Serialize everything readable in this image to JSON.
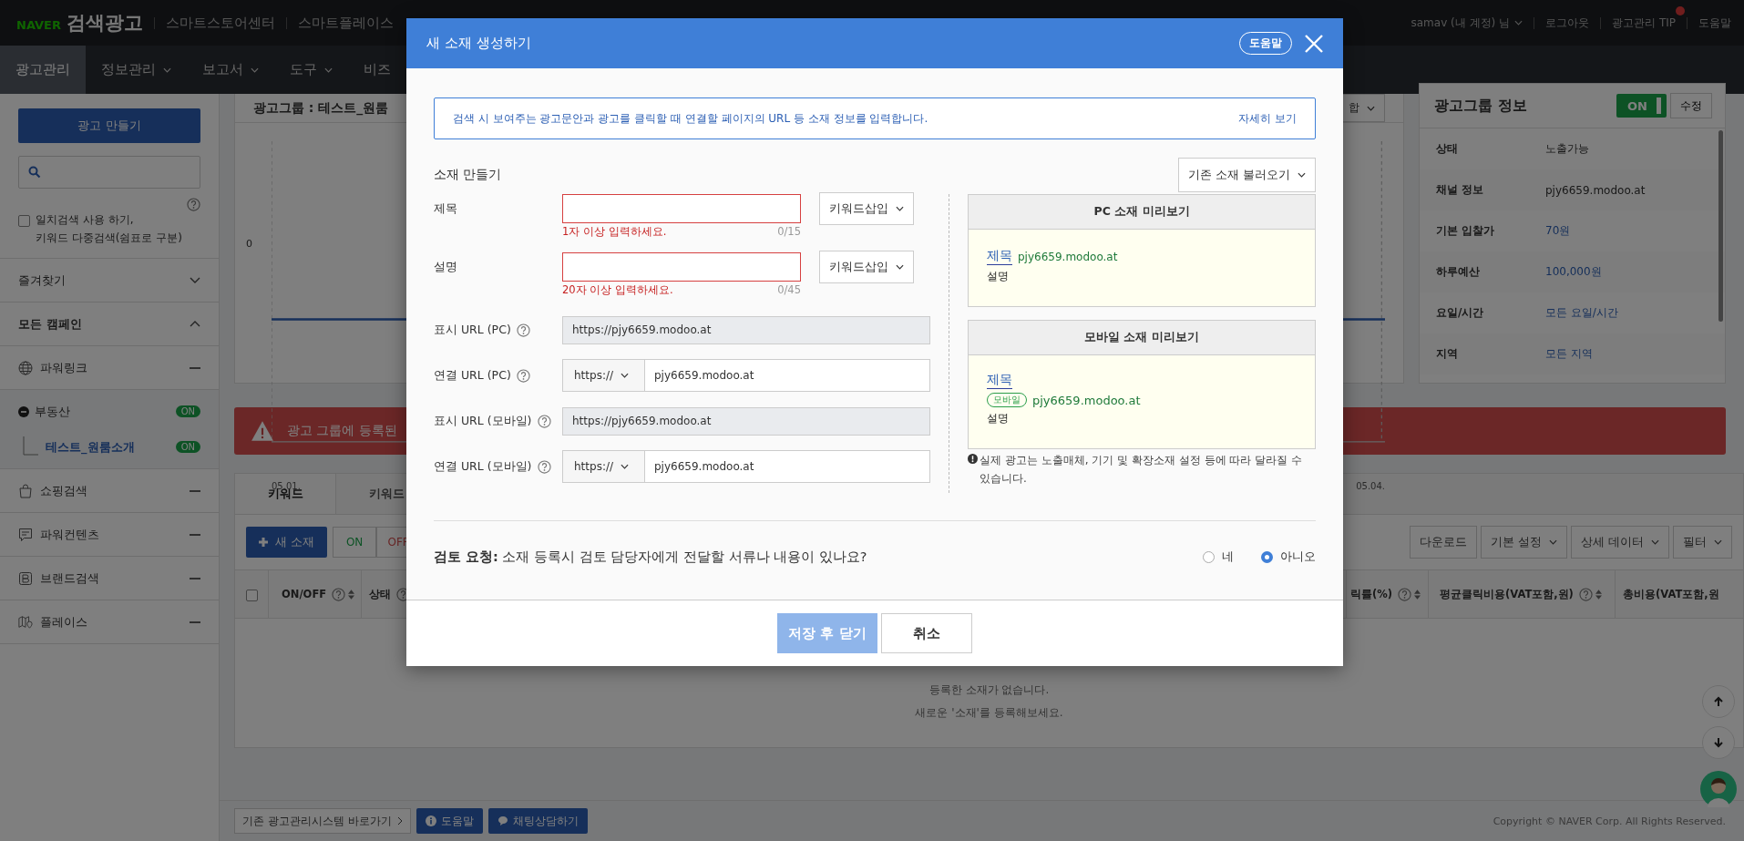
{
  "top_bar": {
    "logo_brand": "NAVER",
    "logo_title": "검색광고",
    "links": [
      "스마트스토어센터",
      "스마트플레이스"
    ],
    "account": "samav (내 계정) 님",
    "logout": "로그아웃",
    "tip": "광고관리 TIP",
    "help": "도움말"
  },
  "nav": [
    {
      "label": "광고관리",
      "selected": true,
      "dropdown": false
    },
    {
      "label": "정보관리",
      "selected": false,
      "dropdown": true
    },
    {
      "label": "보고서",
      "selected": false,
      "dropdown": true
    },
    {
      "label": "도구",
      "selected": false,
      "dropdown": true
    },
    {
      "label": "비즈",
      "selected": false,
      "dropdown": false
    }
  ],
  "sidebar": {
    "create_button": "광고 만들기",
    "match_search": {
      "label": "일치검색 사용 하기,\n키워드 다중검색(쉼표로 구분)",
      "checked": false
    },
    "sections": [
      {
        "label": "즐겨찾기",
        "expanded": false
      },
      {
        "label": "모든 캠페인",
        "expanded": true
      }
    ],
    "campaigns": [
      {
        "kind": "globe",
        "label": "파워링크",
        "children": [
          {
            "label": "부동산",
            "on": true,
            "status": "ON",
            "selected": false,
            "children": [
              {
                "label": "테스트_원룸소개",
                "on": true,
                "status": "ON",
                "selected": true
              }
            ]
          }
        ]
      },
      {
        "kind": "bag",
        "label": "쇼핑검색"
      },
      {
        "kind": "chat",
        "label": "파워컨텐츠"
      },
      {
        "kind": "brand",
        "label": "브랜드검색"
      },
      {
        "kind": "map",
        "label": "플레이스"
      }
    ]
  },
  "ad_group": {
    "title": "광고그룹 : 테스트_원룸",
    "sum_dropdown": "합",
    "chart": {
      "y_tick": "0",
      "x_start": "05.01.",
      "x_end": "05.04."
    }
  },
  "group_info": {
    "title": "광고그룹 정보",
    "on": true,
    "toggle_label": "ON",
    "edit": "수정",
    "rows": [
      {
        "label": "상태",
        "value": "노출가능",
        "link": false
      },
      {
        "label": "채널 정보",
        "value": "pjy6659.modoo.at",
        "link": false
      },
      {
        "label": "기본 입찰가",
        "value": "70원",
        "link": true
      },
      {
        "label": "하루예산",
        "value": "100,000원",
        "link": true
      },
      {
        "label": "요일/시간",
        "value": "모든 요일/시간",
        "link": true
      },
      {
        "label": "지역",
        "value": "모든 지역",
        "link": true
      }
    ]
  },
  "alert": {
    "text": "광고 그룹에 등록된"
  },
  "tabs": [
    {
      "label": "키워드",
      "selected": true
    },
    {
      "label": "키워드",
      "selected": false
    }
  ],
  "toolbar": {
    "new_button": "새 소재",
    "on": "ON",
    "off": "OFF",
    "right": [
      {
        "label": "다운로드",
        "dropdown": false
      },
      {
        "label": "기본 설정",
        "dropdown": true
      },
      {
        "label": "상세 데이터",
        "dropdown": true
      },
      {
        "label": "필터",
        "dropdown": true
      }
    ]
  },
  "table": {
    "select_all_checked": false,
    "columns": [
      {
        "label": "ON/OFF",
        "help": true,
        "sort": true
      },
      {
        "label": "상태",
        "help": true,
        "sort": false
      },
      {
        "label": "릭률(%)",
        "help": true,
        "sort": true
      },
      {
        "label": "평균클릭비용(VAT포함,원)",
        "help": true,
        "sort": true
      },
      {
        "label": "총비용(VAT포함,원",
        "help": false,
        "sort": false
      }
    ],
    "empty": [
      "등록한 소재가 없습니다.",
      "새로운 '소재'를 등록해보세요."
    ]
  },
  "footer": {
    "legacy_link": "기존 광고관리시스템 바로가기",
    "help": "도움말",
    "chat": "채팅상담하기",
    "copyright": "Copyright © NAVER Corp. All Rights Reserved."
  },
  "modal": {
    "title": "새 소재 생성하기",
    "help": "도움말",
    "info": "검색 시 보여주는 광고문안과 광고를 클릭할 때 연결할 페이지의 URL 등 소재 정보를 입력합니다.",
    "info_link": "자세히 보기",
    "section_title": "소재 만들기",
    "load_button": "기존 소재 불러오기",
    "fields": [
      {
        "kind": "text",
        "label": "제목",
        "invalid": true,
        "error": "1자 이상 입력하세요.",
        "counter": "0/15",
        "button": "키워드삽입"
      },
      {
        "kind": "text",
        "label": "설명",
        "invalid": true,
        "error": "20자 이상 입력하세요.",
        "counter": "0/45",
        "button": "키워드삽입"
      },
      {
        "kind": "readonly",
        "label": "표시 URL (PC)",
        "value": "https://pjy6659.modoo.at"
      },
      {
        "kind": "url",
        "label": "연결 URL (PC)",
        "protocol": "https://",
        "value": "pjy6659.modoo.at"
      },
      {
        "kind": "readonly",
        "label": "표시 URL (모바일)",
        "value": "https://pjy6659.modoo.at"
      },
      {
        "kind": "url",
        "label": "연결 URL (모바일)",
        "protocol": "https://",
        "value": "pjy6659.modoo.at"
      }
    ],
    "previews": [
      {
        "kind": "pc",
        "title": "PC 소재 미리보기",
        "headline": "제목",
        "url": "pjy6659.modoo.at",
        "description": "설명"
      },
      {
        "kind": "mobile",
        "title": "모바일 소재 미리보기",
        "headline": "제목",
        "badge": "모바일",
        "url": "pjy6659.modoo.at",
        "description": "설명"
      }
    ],
    "note": "실제 광고는 노출매체, 기기 및 확장소재 설정 등에 따라 달라질 수 있습니다.",
    "review": {
      "question": "**검토 요청:** 소재 등록시 검토 담당자에게 전달할 서류나 내용이 있나요?",
      "options": [
        {
          "label": "네",
          "selected": false
        },
        {
          "label": "아니오",
          "selected": true
        }
      ]
    },
    "buttons": [
      {
        "kind": "primary",
        "label": "저장 후 닫기",
        "disabled": true
      },
      {
        "kind": "secondary",
        "label": "취소",
        "disabled": false
      }
    ]
  }
}
